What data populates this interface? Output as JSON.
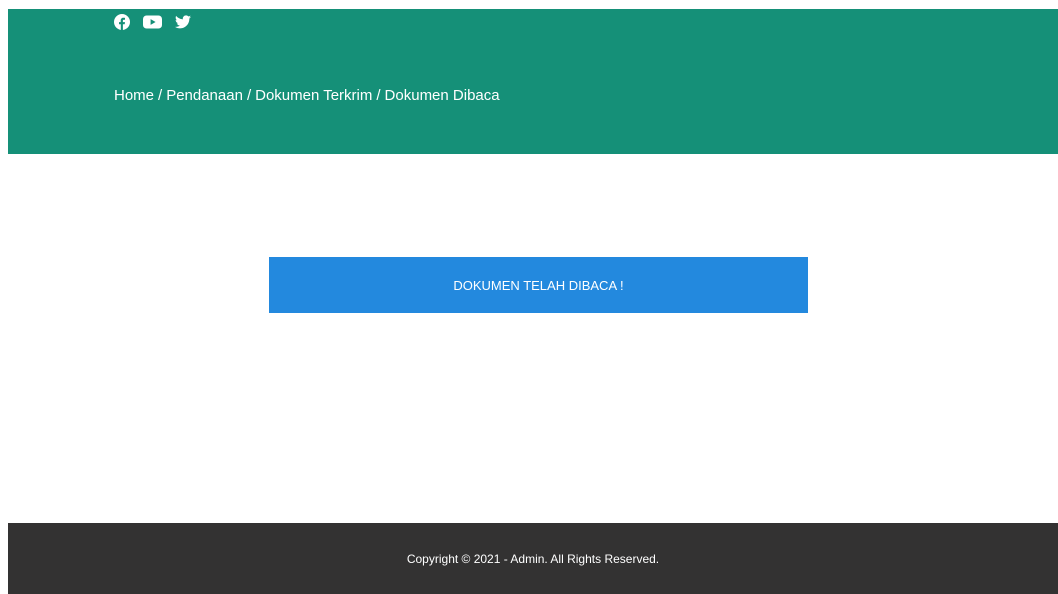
{
  "header": {
    "social": [
      {
        "name": "facebook-icon"
      },
      {
        "name": "youtube-icon"
      },
      {
        "name": "twitter-icon"
      }
    ],
    "breadcrumb": [
      "Home",
      "Pendanaan",
      "Dokumen Terkrim",
      "Dokumen Dibaca"
    ],
    "separator": "/",
    "background_color": "#159078"
  },
  "notice": {
    "text": "DOKUMEN TELAH DIBACA !",
    "background_color": "#2389de"
  },
  "footer": {
    "copyright": "Copyright © 2021 - Admin. All Rights Reserved.",
    "background_color": "#333232"
  }
}
